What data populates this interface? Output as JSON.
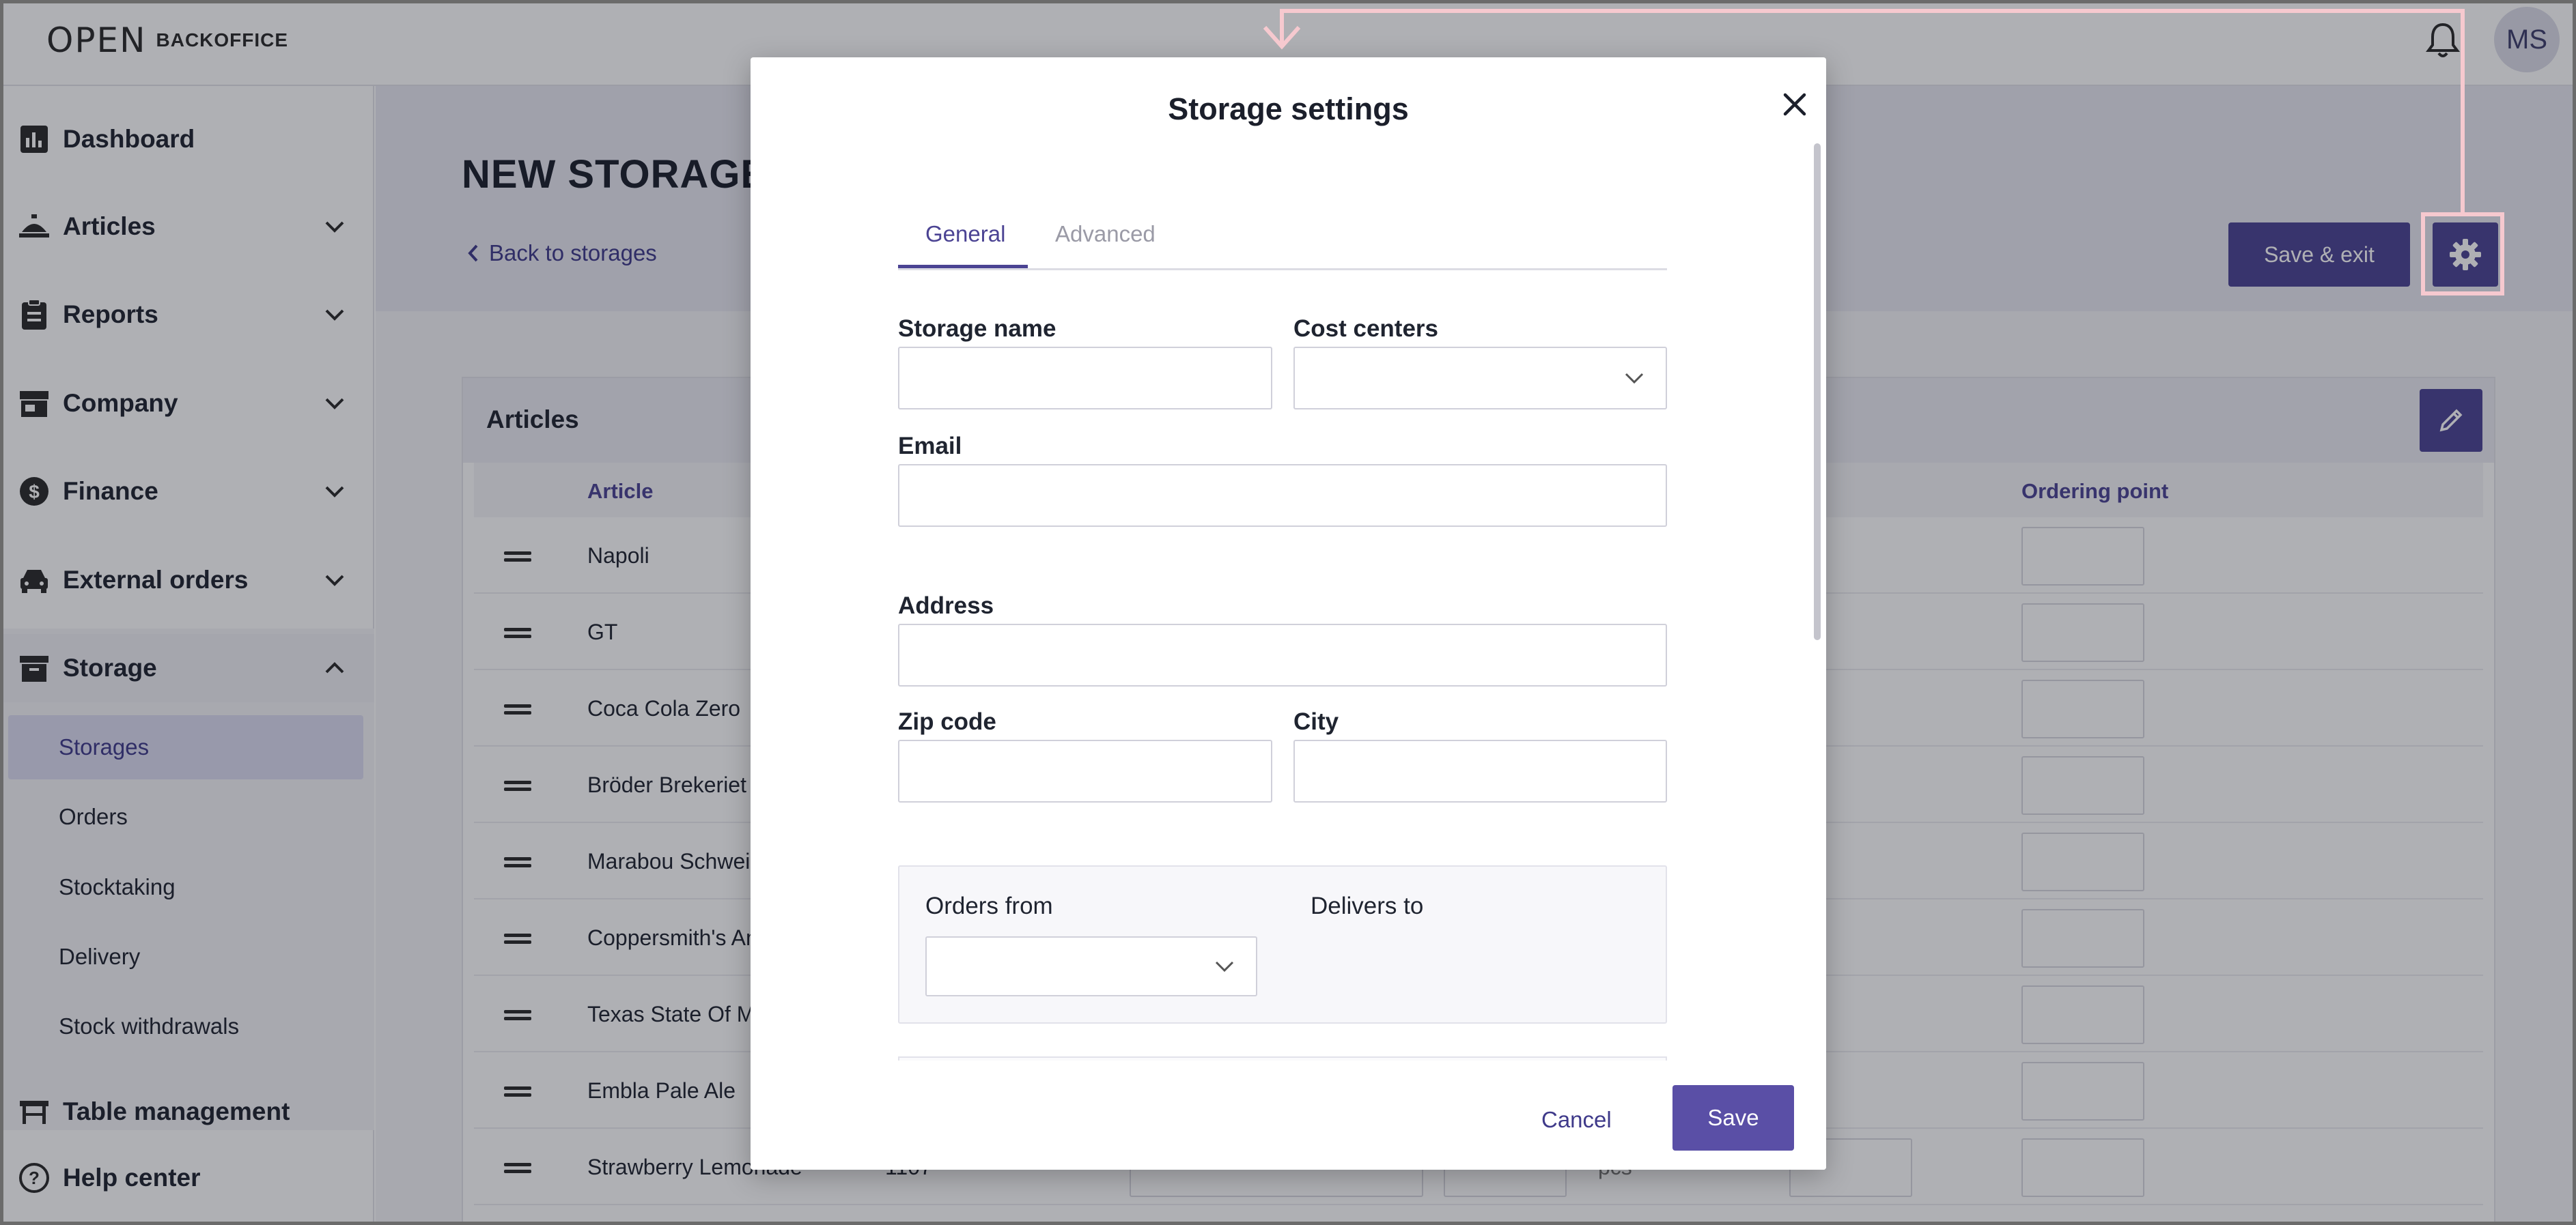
{
  "topbar": {
    "logo_mark": "OPEN",
    "logo_text": "BACKOFFICE",
    "user_initials": "MS"
  },
  "sidebar": {
    "items": [
      {
        "label": "Dashboard",
        "icon": "bar-chart-icon"
      },
      {
        "label": "Articles",
        "icon": "food-tray-icon"
      },
      {
        "label": "Reports",
        "icon": "clipboard-icon"
      },
      {
        "label": "Company",
        "icon": "store-icon"
      },
      {
        "label": "Finance",
        "icon": "dollar-icon"
      },
      {
        "label": "External orders",
        "icon": "car-icon"
      },
      {
        "label": "Storage",
        "icon": "archive-icon"
      }
    ],
    "storage_sub": [
      "Storages",
      "Orders",
      "Stocktaking",
      "Delivery",
      "Stock withdrawals"
    ],
    "table_management": "Table management",
    "help_center": "Help center"
  },
  "page": {
    "title": "NEW STORAGE",
    "back_link": "Back to storages",
    "save_exit": "Save & exit"
  },
  "articles": {
    "title": "Articles",
    "columns": {
      "article": "Article",
      "ordering_point": "Ordering point"
    },
    "rows": [
      {
        "name": "Napoli"
      },
      {
        "name": "GT"
      },
      {
        "name": "Coca Cola Zero"
      },
      {
        "name": "Bröder Brekeriet"
      },
      {
        "name": "Marabou Schweize"
      },
      {
        "name": "Coppersmith's Aml"
      },
      {
        "name": "Texas State Of Min"
      },
      {
        "name": "Embla Pale Ale"
      },
      {
        "name": "Strawberry Lemonade",
        "number": "1107",
        "unit": "pcs"
      }
    ]
  },
  "modal": {
    "title": "Storage settings",
    "tabs": {
      "general": "General",
      "advanced": "Advanced"
    },
    "fields": {
      "storage_name": {
        "label": "Storage name",
        "value": ""
      },
      "cost_centers": {
        "label": "Cost centers",
        "value": ""
      },
      "email": {
        "label": "Email",
        "value": ""
      },
      "address": {
        "label": "Address",
        "value": ""
      },
      "zip_code": {
        "label": "Zip code",
        "value": ""
      },
      "city": {
        "label": "City",
        "value": ""
      }
    },
    "orders_from": "Orders from",
    "delivers_to": "Delivers to",
    "cancel": "Cancel",
    "save": "Save"
  },
  "colors": {
    "accent": "#4b4393",
    "highlight": "#f6c9cf"
  }
}
